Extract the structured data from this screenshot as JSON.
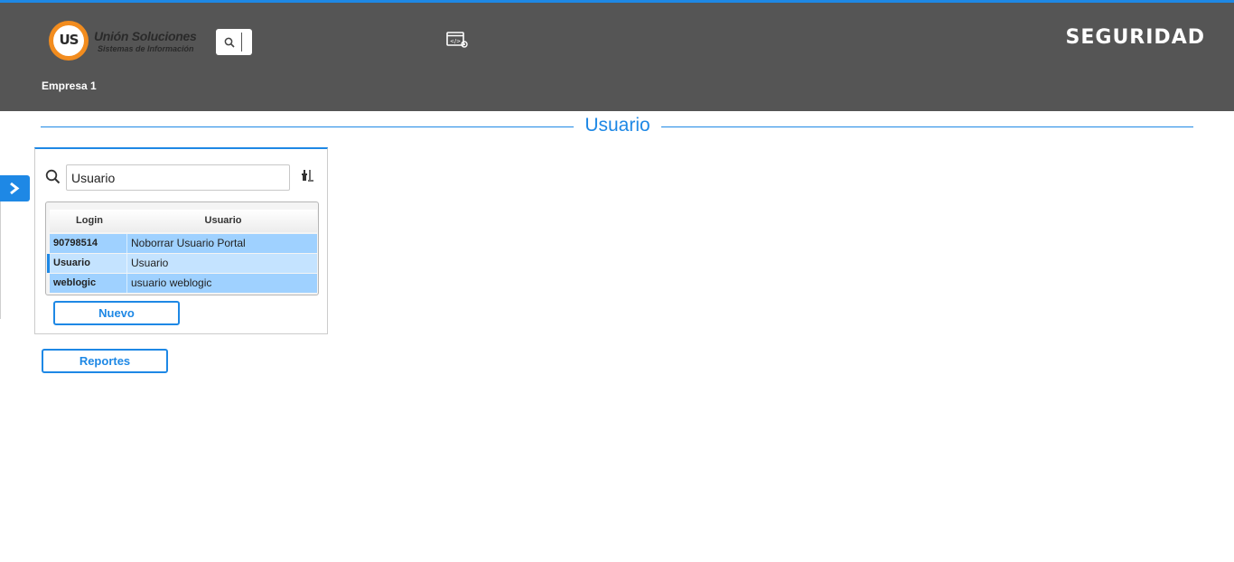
{
  "header": {
    "logo_title": "Unión Soluciones",
    "logo_subtitle": "Sistemas de Información",
    "logo_mark": "US",
    "brand": "SEGURIDAD",
    "company": "Empresa 1",
    "search_icon": "search-icon",
    "tool_icon": "code-settings-icon"
  },
  "page": {
    "title": "Usuario"
  },
  "sidebar": {
    "toggle_icon": "chevron-right-icon"
  },
  "panel": {
    "search": {
      "value": "Usuario",
      "icon": "search-icon"
    },
    "filter_icon": "clear-filter-icon",
    "table": {
      "columns": [
        "Login",
        "Usuario"
      ],
      "rows": [
        {
          "login": "90798514",
          "usuario": "Noborrar Usuario Portal",
          "selected": false
        },
        {
          "login": "Usuario",
          "usuario": "Usuario",
          "selected": true
        },
        {
          "login": "weblogic",
          "usuario": "usuario weblogic",
          "selected": false
        }
      ]
    },
    "new_button": "Nuevo"
  },
  "reports_button": "Reportes",
  "colors": {
    "accent": "#1e88e5",
    "header_bg": "#555555",
    "row": "#9fd1ff",
    "row_selected": "#c4e3ff",
    "logo_orange": "#f28c1e"
  }
}
